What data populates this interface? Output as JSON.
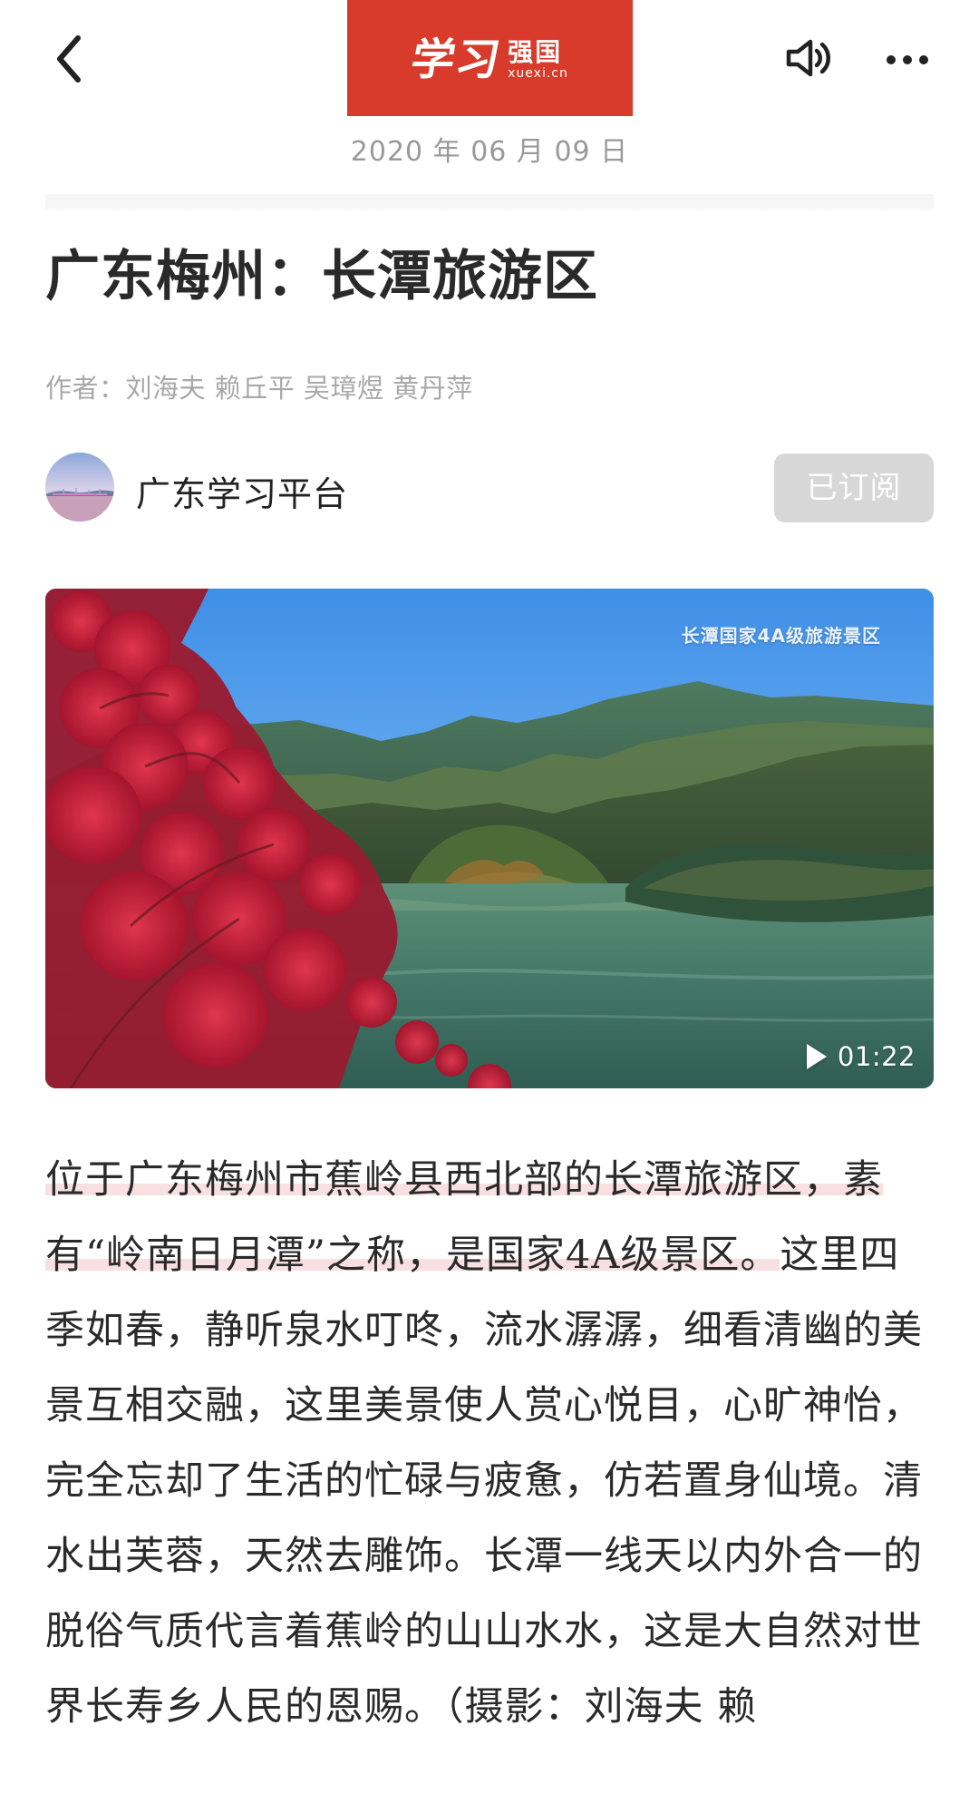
{
  "header": {
    "back_icon": "chevron-left-icon",
    "logo_main": "学习",
    "logo_sub": "强国",
    "logo_url": "xuexi.cn",
    "sound_icon": "speaker-icon",
    "more_icon": "more-icon",
    "date": "2020 年 06 月 09 日"
  },
  "article": {
    "title": "广东梅州：长潭旅游区",
    "author": "作者：刘海夫 赖丘平 吴璋煜 黄丹萍",
    "channel_name": "广东学习平台",
    "subscribe_label": "已订阅",
    "video_caption": "长潭国家4A级旅游景区",
    "video_duration": "01:22",
    "highlight_text": "位于广东梅州市蕉岭县西北部的长潭旅游区，素有“岭南日月潭”之称，是国家4A级景区。",
    "body_text": "这里四季如春，静听泉水叮咚，流水潺潺，细看清幽的美景互相交融，这里美景使人赏心悦目，心旷神怡，完全忘却了生活的忙碌与疲惫，仿若置身仙境。清水出芙蓉，天然去雕饰。长潭一线天以内外合一的脱俗气质代言着蕉岭的山山水水，这是大自然对世界长寿乡人民的恩赐。（摄影：刘海夫 赖"
  },
  "colors": {
    "brand_red": "#d83b2b",
    "date_text": "#999999",
    "author_text": "#a8a8a8",
    "subscribe_bg": "#d7d7d7",
    "highlight_pink": "#f8dfe1"
  }
}
